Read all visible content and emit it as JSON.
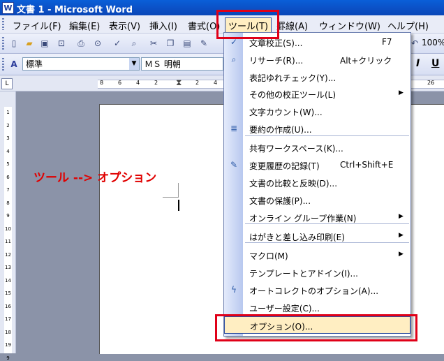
{
  "window": {
    "title": "文書 1 - Microsoft Word",
    "app_icon": "W"
  },
  "menubar": {
    "items": [
      {
        "label": "ファイル(F)"
      },
      {
        "label": "編集(E)"
      },
      {
        "label": "表示(V)"
      },
      {
        "label": "挿入(I)"
      },
      {
        "label": "書式(O)"
      },
      {
        "label": "ツール(T)"
      },
      {
        "label": "罫線(A)"
      },
      {
        "label": "ウィンドウ(W)"
      },
      {
        "label": "ヘルプ(H)"
      }
    ]
  },
  "toolbar": {
    "zoom": "100%",
    "style_combo": "標準",
    "font_combo": "ＭＳ 明朝",
    "right_glyphs": "I U"
  },
  "ruler": {
    "tab_marker": "L",
    "numbers": [
      "8",
      "6",
      "4",
      "2",
      "2",
      "4",
      "26"
    ]
  },
  "vertical_ruler": {
    "numbers": [
      "1",
      "2",
      "3",
      "4",
      "5",
      "6",
      "7",
      "8",
      "9",
      "10",
      "11",
      "12",
      "13",
      "14",
      "15",
      "16",
      "17",
      "18",
      "19",
      "9"
    ]
  },
  "annotation": {
    "text": "ツール --> オプション",
    "color": "#e00000"
  },
  "tools_menu": {
    "items": [
      {
        "label": "文章校正(S)...",
        "shortcut": "F7",
        "icon": "spellcheck-icon"
      },
      {
        "label": "リサーチ(R)...",
        "shortcut": "Alt+クリック",
        "icon": "research-icon"
      },
      {
        "label": "表記ゆれチェック(Y)..."
      },
      {
        "label": "その他の校正ツール(L)",
        "submenu": true
      },
      {
        "label": "文字カウント(W)..."
      },
      {
        "label": "要約の作成(U)...",
        "icon": "summarize-icon"
      },
      {
        "label": "共有ワークスペース(K)..."
      },
      {
        "label": "変更履歴の記録(T)",
        "shortcut": "Ctrl+Shift+E",
        "icon": "track-changes-icon"
      },
      {
        "label": "文書の比較と反映(D)..."
      },
      {
        "label": "文書の保護(P)..."
      },
      {
        "label": "オンライン グループ作業(N)",
        "submenu": true
      },
      {
        "label": "はがきと差し込み印刷(E)",
        "submenu": true
      },
      {
        "label": "マクロ(M)",
        "submenu": true
      },
      {
        "label": "テンプレートとアドイン(I)..."
      },
      {
        "label": "オートコレクトのオプション(A)...",
        "icon": "autocorrect-icon"
      },
      {
        "label": "ユーザー設定(C)..."
      },
      {
        "label": "オプション(O)...",
        "highlighted": true
      }
    ]
  },
  "colors": {
    "accent_red": "#e00018",
    "highlight": "#ffeec2",
    "titlebar": "#0b4fc4"
  }
}
